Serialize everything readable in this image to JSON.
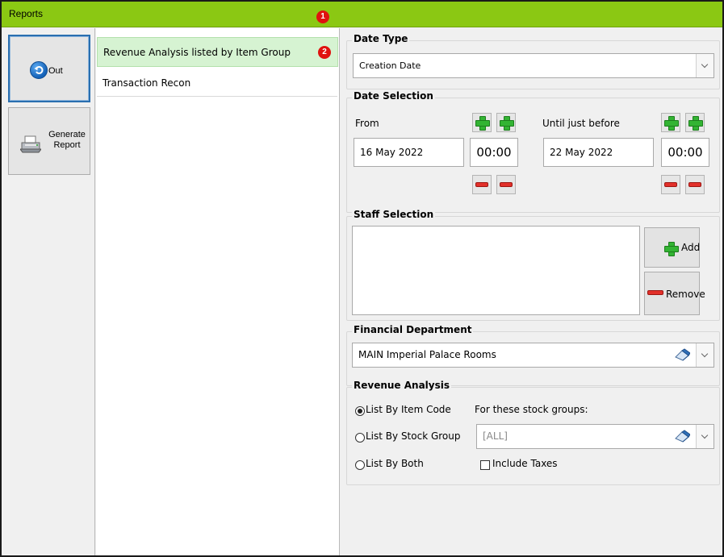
{
  "window": {
    "title": "Reports"
  },
  "badges": {
    "one": "1",
    "two": "2"
  },
  "sidebar": {
    "out_label": "Out",
    "generate_label_line1": "Generate",
    "generate_label_line2": "Report"
  },
  "reports": {
    "items": [
      {
        "label": "Revenue Analysis listed by Item Group",
        "selected": true
      },
      {
        "label": "Transaction Recon",
        "selected": false
      }
    ]
  },
  "date_type": {
    "legend": "Date Type",
    "value": "Creation Date"
  },
  "date_selection": {
    "legend": "Date Selection",
    "from_label": "From",
    "from_date": "16 May 2022",
    "from_time": "00:00",
    "until_label": "Until just before",
    "until_date": "22 May 2022",
    "until_time": "00:00"
  },
  "staff_selection": {
    "legend": "Staff Selection",
    "add_label": "Add",
    "remove_label": "Remove"
  },
  "financial_department": {
    "legend": "Financial Department",
    "value": "MAIN Imperial Palace Rooms"
  },
  "revenue_analysis": {
    "legend": "Revenue Analysis",
    "option_item_code": "List By Item Code",
    "option_stock_group": "List By Stock Group",
    "option_both": "List By Both",
    "selected_option": "List By Item Code",
    "stock_groups_label": "For these stock groups:",
    "stock_groups_value": "[ALL]",
    "include_taxes_label": "Include Taxes",
    "include_taxes_checked": false
  },
  "colors": {
    "titlebar": "#8bc813",
    "selected_row": "#d6f3d2",
    "badge": "#e0120f",
    "plus": "#33b433",
    "minus": "#e2302a"
  },
  "icons": [
    "back-arrow-icon",
    "printer-icon",
    "plus-icon",
    "minus-icon",
    "eraser-icon",
    "chevron-down-icon"
  ]
}
